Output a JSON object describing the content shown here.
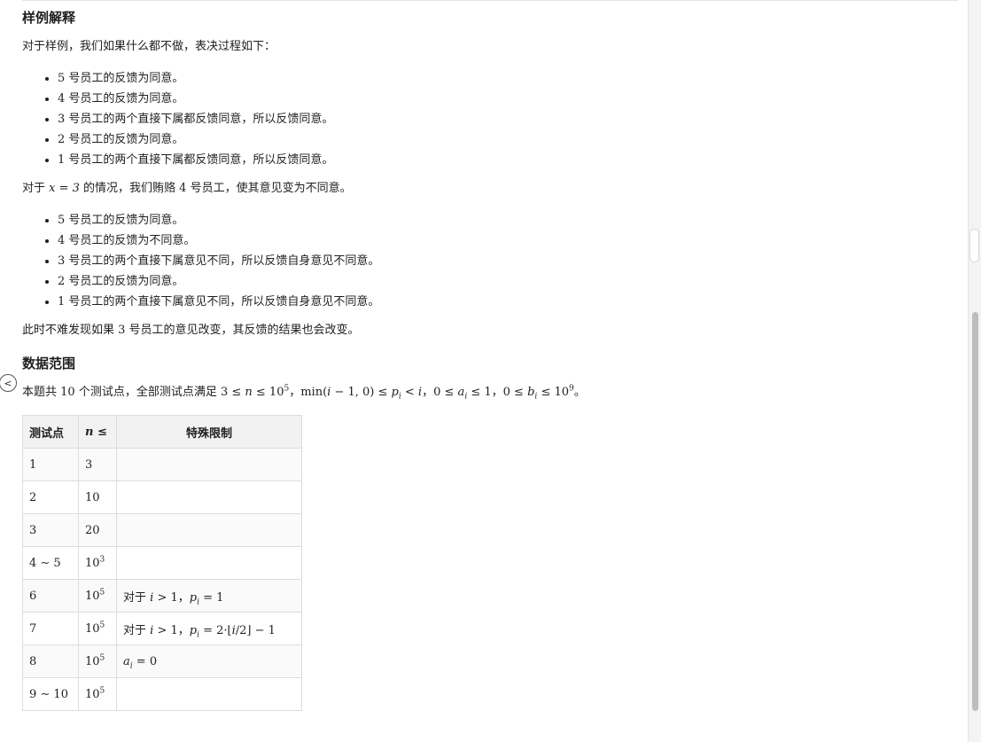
{
  "sample_title": "样例解释",
  "sample_intro": "对于样例，我们如果什么都不做，表决过程如下：",
  "list1": [
    {
      "num": "5",
      "text": " 号员工的反馈为同意。"
    },
    {
      "num": "4",
      "text": " 号员工的反馈为同意。"
    },
    {
      "num": "3",
      "text": " 号员工的两个直接下属都反馈同意，所以反馈同意。"
    },
    {
      "num": "2",
      "text": " 号员工的反馈为同意。"
    },
    {
      "num": "1",
      "text": " 号员工的两个直接下属都反馈同意，所以反馈同意。"
    }
  ],
  "case_intro": {
    "prefix": "对于 ",
    "math": "x = 3",
    "mid": " 的情况，我们贿赂 ",
    "num": "4",
    "suffix": " 号员工，使其意见变为不同意。"
  },
  "list2": [
    {
      "num": "5",
      "text": " 号员工的反馈为同意。"
    },
    {
      "num": "4",
      "text": " 号员工的反馈为不同意。"
    },
    {
      "num": "3",
      "text": " 号员工的两个直接下属意见不同，所以反馈自身意见不同意。"
    },
    {
      "num": "2",
      "text": " 号员工的反馈为同意。"
    },
    {
      "num": "1",
      "text": " 号员工的两个直接下属意见不同，所以反馈自身意见不同意。"
    }
  ],
  "conclusion": {
    "prefix": "此时不难发现如果 ",
    "num": "3",
    "suffix": " 号员工的意见改变，其反馈的结果也会改变。"
  },
  "range_title": "数据范围",
  "range_text": {
    "prefix": "本题共 ",
    "num": "10",
    "mid": " 个测试点，全部测试点满足 ",
    "sep": "，",
    "end": "。"
  },
  "table": {
    "headers": [
      "测试点",
      "n ≤",
      "特殊限制"
    ],
    "rows": [
      {
        "id": "1",
        "n": "3",
        "limit": ""
      },
      {
        "id": "2",
        "n": "10",
        "limit": ""
      },
      {
        "id": "3",
        "n": "20",
        "limit": ""
      },
      {
        "id": "4 ∼ 5",
        "n": "10^3",
        "limit": ""
      },
      {
        "id": "6",
        "n": "10^5",
        "limit": "对于 i > 1，p_i = 1"
      },
      {
        "id": "7",
        "n": "10^5",
        "limit": "对于 i > 1，p_i = 2·⌊i/2⌋ − 1"
      },
      {
        "id": "8",
        "n": "10^5",
        "limit": "a_i = 0"
      },
      {
        "id": "9 ∼ 10",
        "n": "10^5",
        "limit": ""
      }
    ]
  }
}
